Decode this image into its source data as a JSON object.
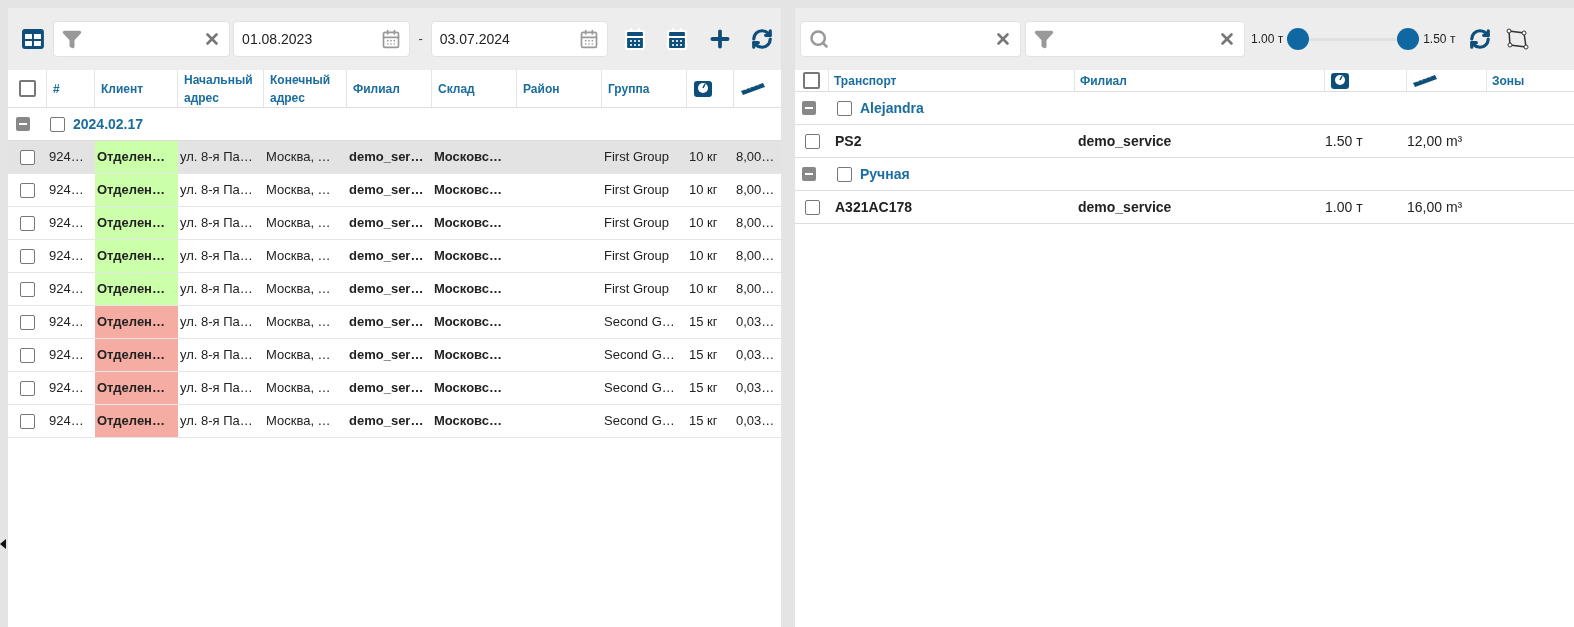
{
  "left": {
    "date_from": "01.08.2023",
    "date_separator": "-",
    "date_to": "03.07.2024",
    "table": {
      "header_checked": false,
      "columns": [
        {
          "kind": "text",
          "label": "#"
        },
        {
          "kind": "text",
          "label": "Клиент"
        },
        {
          "kind": "text",
          "label": "Начальный адрес"
        },
        {
          "kind": "text",
          "label": "Конечный адрес"
        },
        {
          "kind": "text",
          "label": "Филиал"
        },
        {
          "kind": "text",
          "label": "Склад"
        },
        {
          "kind": "text",
          "label": "Район"
        },
        {
          "kind": "text",
          "label": "Группа"
        },
        {
          "kind": "weight"
        },
        {
          "kind": "volume"
        }
      ],
      "groups": [
        {
          "label": "2024.02.17",
          "expanded": true,
          "checked": false,
          "rows": [
            {
              "checked": false,
              "selected": true,
              "color": "#ccffaa",
              "number": "924…",
              "client": "Отделен…",
              "start_address": "ул. 8-я Па…",
              "end_address": "Москва, …",
              "branch": "demo_ser…",
              "warehouse": "Московс…",
              "group": "First Group",
              "weight": "10 кг",
              "volume": "8,00…"
            },
            {
              "checked": false,
              "selected": false,
              "color": "#ccffaa",
              "number": "924…",
              "client": "Отделен…",
              "start_address": "ул. 8-я Па…",
              "end_address": "Москва, …",
              "branch": "demo_ser…",
              "warehouse": "Московс…",
              "group": "First Group",
              "weight": "10 кг",
              "volume": "8,00…"
            },
            {
              "checked": false,
              "selected": false,
              "color": "#ccffaa",
              "number": "924…",
              "client": "Отделен…",
              "start_address": "ул. 8-я Па…",
              "end_address": "Москва, …",
              "branch": "demo_ser…",
              "warehouse": "Московс…",
              "group": "First Group",
              "weight": "10 кг",
              "volume": "8,00…"
            },
            {
              "checked": false,
              "selected": false,
              "color": "#ccffaa",
              "number": "924…",
              "client": "Отделен…",
              "start_address": "ул. 8-я Па…",
              "end_address": "Москва, …",
              "branch": "demo_ser…",
              "warehouse": "Московс…",
              "group": "First Group",
              "weight": "10 кг",
              "volume": "8,00…"
            },
            {
              "checked": false,
              "selected": false,
              "color": "#ccffaa",
              "number": "924…",
              "client": "Отделен…",
              "start_address": "ул. 8-я Па…",
              "end_address": "Москва, …",
              "branch": "demo_ser…",
              "warehouse": "Московс…",
              "group": "First Group",
              "weight": "10 кг",
              "volume": "8,00…"
            },
            {
              "checked": false,
              "selected": false,
              "color": "#f5aca2",
              "number": "924…",
              "client": "Отделен…",
              "start_address": "ул. 8-я Па…",
              "end_address": "Москва, …",
              "branch": "demo_ser…",
              "warehouse": "Московс…",
              "group": "Second G…",
              "weight": "15 кг",
              "volume": "0,03…"
            },
            {
              "checked": false,
              "selected": false,
              "color": "#f5aca2",
              "number": "924…",
              "client": "Отделен…",
              "start_address": "ул. 8-я Па…",
              "end_address": "Москва, …",
              "branch": "demo_ser…",
              "warehouse": "Московс…",
              "group": "Second G…",
              "weight": "15 кг",
              "volume": "0,03…"
            },
            {
              "checked": false,
              "selected": false,
              "color": "#f5aca2",
              "number": "924…",
              "client": "Отделен…",
              "start_address": "ул. 8-я Па…",
              "end_address": "Москва, …",
              "branch": "demo_ser…",
              "warehouse": "Московс…",
              "group": "Second G…",
              "weight": "15 кг",
              "volume": "0,03…"
            },
            {
              "checked": false,
              "selected": false,
              "color": "#f5aca2",
              "number": "924…",
              "client": "Отделен…",
              "start_address": "ул. 8-я Па…",
              "end_address": "Москва, …",
              "branch": "demo_ser…",
              "warehouse": "Московс…",
              "group": "Second G…",
              "weight": "15 кг",
              "volume": "0,03…"
            }
          ]
        }
      ]
    }
  },
  "right": {
    "slider": {
      "min_label": "1.00 т",
      "max_label": "1.50 т",
      "thumbs": [
        {
          "level": 0
        },
        {
          "level": 1
        }
      ]
    },
    "table": {
      "header_checked": false,
      "columns": [
        {
          "kind": "text",
          "label": "Транспорт"
        },
        {
          "kind": "text",
          "label": "Филиал"
        },
        {
          "kind": "weight"
        },
        {
          "kind": "volume"
        },
        {
          "kind": "text",
          "label": "Зоны"
        }
      ],
      "groups": [
        {
          "label": "Alejandra",
          "expanded": true,
          "checked": false,
          "rows": [
            {
              "checked": false,
              "vehicle": "PS2",
              "branch": "demo_service",
              "capacity": "1.50 т",
              "volume": "12,00 m³"
            }
          ]
        },
        {
          "label": "Ручная",
          "expanded": true,
          "checked": false,
          "rows": [
            {
              "checked": false,
              "vehicle": "A321AC178",
              "branch": "demo_service",
              "capacity": "1.00 т",
              "volume": "16,00 m³"
            }
          ]
        }
      ]
    }
  }
}
